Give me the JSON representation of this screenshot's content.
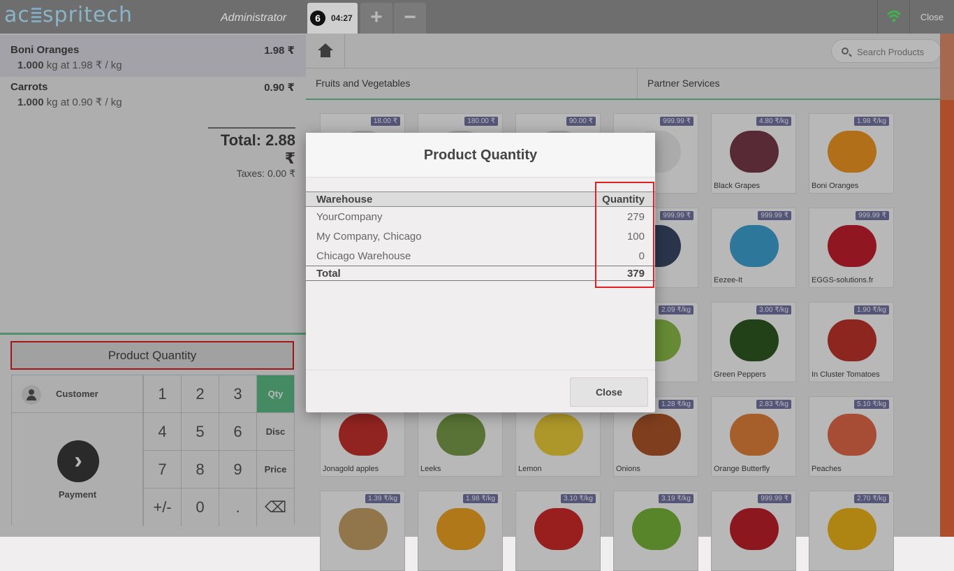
{
  "header": {
    "logo_left": "ac",
    "logo_right": "spritech",
    "username": "Administrator",
    "order_number": "6",
    "order_time": "04:27",
    "add_label": "+",
    "remove_label": "−",
    "close_label": "Close"
  },
  "order": {
    "lines": [
      {
        "name": "Boni Oranges",
        "price": "1.98 ₹",
        "qty": "1.000",
        "info": " kg at 1.98 ₹ / kg"
      },
      {
        "name": "Carrots",
        "price": "0.90 ₹",
        "qty": "1.000",
        "info": " kg at 0.90 ₹ / kg"
      }
    ],
    "total": "Total: 2.88 ₹",
    "taxes": "Taxes: 0.00 ₹"
  },
  "actions": {
    "product_quantity": "Product Quantity",
    "customer": "Customer",
    "payment": "Payment"
  },
  "numpad": {
    "keys": [
      "1",
      "2",
      "3",
      "4",
      "5",
      "6",
      "7",
      "8",
      "9",
      "+/-",
      "0",
      "."
    ],
    "modes": [
      "Qty",
      "Disc",
      "Price"
    ],
    "backspace": "⌫",
    "active_mode": "Qty"
  },
  "search": {
    "placeholder": "Search Products"
  },
  "categories": [
    "Fruits and Vegetables",
    "Partner Services"
  ],
  "products": [
    {
      "name": "",
      "price": "18.00 ₹"
    },
    {
      "name": "",
      "price": "180.00 ₹"
    },
    {
      "name": "",
      "price": "90.00 ₹"
    },
    {
      "name": "",
      "price": "999.99 ₹"
    },
    {
      "name": "Black Grapes",
      "price": "4.80 ₹/kg"
    },
    {
      "name": "Boni Oranges",
      "price": "1.98 ₹/kg"
    },
    {
      "name": "",
      "price": ""
    },
    {
      "name": "",
      "price": ""
    },
    {
      "name": "",
      "price": ""
    },
    {
      "name": "",
      "price": "999.99 ₹"
    },
    {
      "name": "Eezee-It",
      "price": "999.99 ₹"
    },
    {
      "name": "EGGS-solutions.fr",
      "price": "999.99 ₹"
    },
    {
      "name": "",
      "price": ""
    },
    {
      "name": "",
      "price": ""
    },
    {
      "name": "",
      "price": ""
    },
    {
      "name": "th apples",
      "price": "2.09 ₹/kg"
    },
    {
      "name": "Green Peppers",
      "price": "3.00 ₹/kg"
    },
    {
      "name": "In Cluster Tomatoes",
      "price": "1.90 ₹/kg"
    },
    {
      "name": "Jonagold apples",
      "price": ""
    },
    {
      "name": "Leeks",
      "price": ""
    },
    {
      "name": "Lemon",
      "price": ""
    },
    {
      "name": "Onions",
      "price": "1.28 ₹/kg"
    },
    {
      "name": "Orange Butterfly",
      "price": "2.83 ₹/kg"
    },
    {
      "name": "Peaches",
      "price": "5.10 ₹/kg"
    },
    {
      "name": "",
      "price": "1.39 ₹/kg"
    },
    {
      "name": "",
      "price": "1.98 ₹/kg"
    },
    {
      "name": "",
      "price": "3.10 ₹/kg"
    },
    {
      "name": "",
      "price": "3.19 ₹/kg"
    },
    {
      "name": "",
      "price": "999.99 ₹"
    },
    {
      "name": "",
      "price": "2.70 ₹/kg"
    }
  ],
  "modal": {
    "title": "Product Quantity",
    "col_warehouse": "Warehouse",
    "col_quantity": "Quantity",
    "rows": [
      {
        "warehouse": "YourCompany",
        "quantity": "279"
      },
      {
        "warehouse": "My Company, Chicago",
        "quantity": "100"
      },
      {
        "warehouse": "Chicago Warehouse",
        "quantity": "0"
      }
    ],
    "total_label": "Total",
    "total_value": "379",
    "close_label": "Close"
  },
  "colors": {
    "accent_green": "#5ec08a",
    "highlight_red": "#e02020",
    "price_tag": "#7476a6"
  }
}
